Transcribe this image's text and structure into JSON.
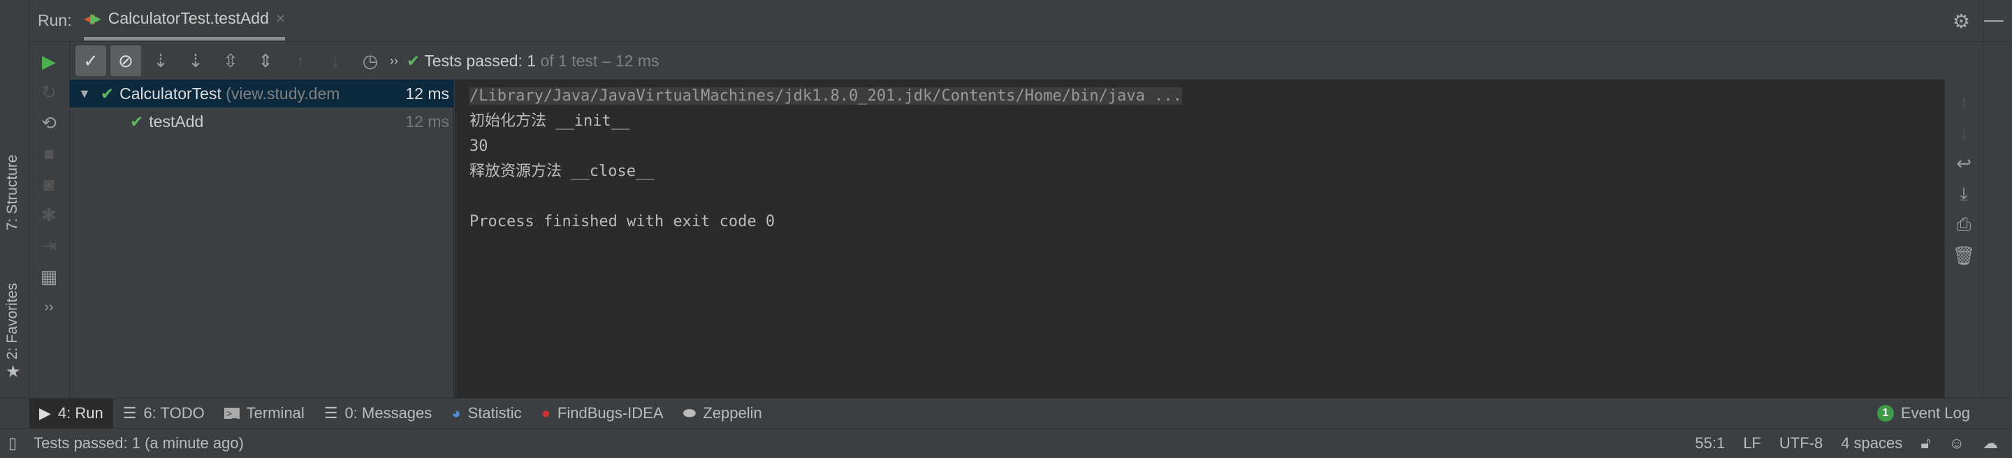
{
  "run_tab": {
    "label": "Run:",
    "tab_title": "CalculatorTest.testAdd",
    "close": "×"
  },
  "left_stripe": {
    "structure": "7: Structure",
    "favorites": "2: Favorites"
  },
  "toolbar": {
    "more": "››",
    "status_bold": "Tests passed: 1",
    "status_rest": " of 1 test – 12 ms"
  },
  "tree": [
    {
      "name": "CalculatorTest",
      "package": " (view.study.dem",
      "time": "12 ms",
      "selected": true
    },
    {
      "name": "testAdd",
      "time": "12 ms",
      "selected": false
    }
  ],
  "console": {
    "lines": [
      "/Library/Java/JavaVirtualMachines/jdk1.8.0_201.jdk/Contents/Home/bin/java ...",
      "初始化方法 __init__",
      "30",
      "释放资源方法 __close__",
      "",
      "Process finished with exit code 0"
    ]
  },
  "bottom_tools": [
    {
      "label": "4: Run",
      "icon": "play-icon",
      "active": true
    },
    {
      "label": "6: TODO",
      "icon": "list-icon"
    },
    {
      "label": "Terminal",
      "icon": "terminal-icon"
    },
    {
      "label": "0: Messages",
      "icon": "messages-icon"
    },
    {
      "label": "Statistic",
      "icon": "statistic-icon"
    },
    {
      "label": "FindBugs-IDEA",
      "icon": "bug-icon"
    },
    {
      "label": "Zeppelin",
      "icon": "zeppelin-icon"
    }
  ],
  "event_log": {
    "count": "1",
    "label": "Event Log"
  },
  "status": {
    "message": "Tests passed: 1 (a minute ago)",
    "position": "55:1",
    "line_sep": "LF",
    "encoding": "UTF-8",
    "indent": "4 spaces"
  },
  "colors": {
    "pass": "#5fb95f",
    "selected_row": "#0d293e",
    "console_bg": "#2b2b2b",
    "panel_bg": "#3c3f41"
  }
}
